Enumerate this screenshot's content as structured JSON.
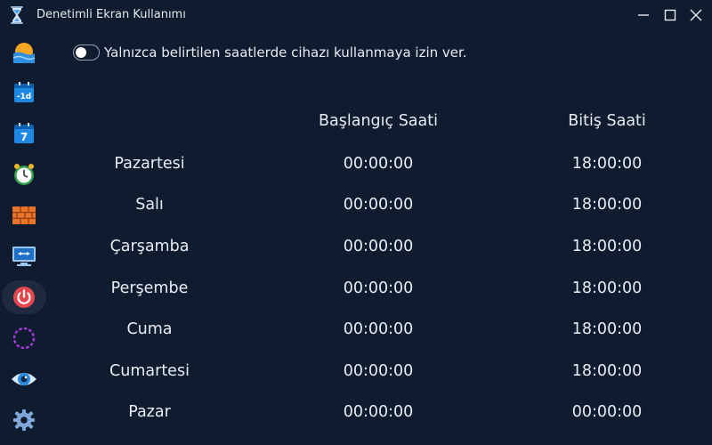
{
  "window": {
    "title": "Denetimli Ekran Kullanımı",
    "controls": [
      "minimize",
      "maximize",
      "close"
    ]
  },
  "sidebar": {
    "items": [
      {
        "icon": "sunset-icon"
      },
      {
        "icon": "calendar-day-icon",
        "text": "-1d"
      },
      {
        "icon": "calendar-week-icon",
        "text": "7"
      },
      {
        "icon": "alarm-clock-icon"
      },
      {
        "icon": "firewall-icon"
      },
      {
        "icon": "remote-desktop-icon"
      },
      {
        "icon": "power-icon",
        "active": true
      },
      {
        "icon": "dotted-circle-icon"
      },
      {
        "icon": "eye-icon"
      },
      {
        "icon": "settings-gear-icon"
      }
    ]
  },
  "restriction": {
    "toggle_label": "Yalnızca belirtilen saatlerde cihazı kullanmaya izin ver.",
    "enabled": false
  },
  "schedule": {
    "headers": {
      "start": "Başlangıç Saati",
      "end": "Bitiş Saati"
    },
    "rows": [
      {
        "day": "Pazartesi",
        "start": "00:00:00",
        "end": "18:00:00"
      },
      {
        "day": "Salı",
        "start": "00:00:00",
        "end": "18:00:00"
      },
      {
        "day": "Çarşamba",
        "start": "00:00:00",
        "end": "18:00:00"
      },
      {
        "day": "Perşembe",
        "start": "00:00:00",
        "end": "18:00:00"
      },
      {
        "day": "Cuma",
        "start": "00:00:00",
        "end": "18:00:00"
      },
      {
        "day": "Cumartesi",
        "start": "00:00:00",
        "end": "18:00:00"
      },
      {
        "day": "Pazar",
        "start": "00:00:00",
        "end": "00:00:00"
      }
    ]
  },
  "colors": {
    "background": "#0f1b2f",
    "active_item": "#1e2a3d",
    "text": "#e8ecf3",
    "power_red": "#e5474f"
  }
}
